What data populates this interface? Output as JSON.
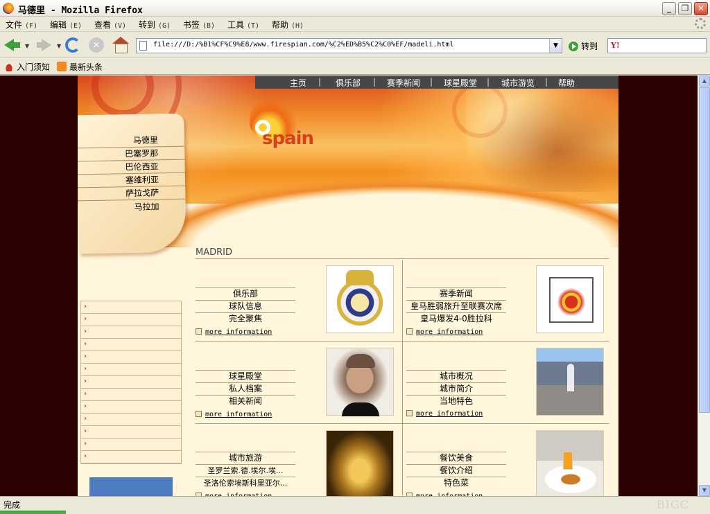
{
  "window": {
    "title": "马德里 - Mozilla Firefox"
  },
  "menu": [
    {
      "label": "文件",
      "key": "(F)"
    },
    {
      "label": "编辑",
      "key": "(E)"
    },
    {
      "label": "查看",
      "key": "(V)"
    },
    {
      "label": "转到",
      "key": "(G)"
    },
    {
      "label": "书签",
      "key": "(B)"
    },
    {
      "label": "工具",
      "key": "(T)"
    },
    {
      "label": "帮助",
      "key": "(H)"
    }
  ],
  "navbar": {
    "url": "file:///D:/%B1%CF%C9%E8/www.firespian.com/%C2%ED%B5%C2%C0%EF/madeli.html",
    "go_label": "转到",
    "search_engine": "Y!"
  },
  "bookmarks": [
    {
      "label": "入门须知",
      "icon": "hat-icon"
    },
    {
      "label": "最新头条",
      "icon": "rss-icon"
    }
  ],
  "site": {
    "topnav": [
      "主页",
      "俱乐部",
      "赛季新闻",
      "球星殿堂",
      "城市游览",
      "帮助"
    ],
    "logo_text": "spain",
    "cities": [
      "马德里",
      "巴塞罗那",
      "巴伦西亚",
      "塞维利亚",
      "萨拉戈萨",
      "马拉加"
    ],
    "section_title": "MADRID",
    "more_label": "more information",
    "cells": [
      {
        "links": [
          "俱乐部",
          "球队信息",
          "完全聚焦"
        ],
        "photo": "real-madrid-crest"
      },
      {
        "links": [
          "赛季新闻",
          "皇马胜弱旅升至联赛次席",
          "皇马爆发4-0胜拉科"
        ],
        "photo": "rfef-crest"
      },
      {
        "links": [
          "球星殿堂",
          "私人档案",
          "相关新闻"
        ],
        "photo": "player-portrait"
      },
      {
        "links": [
          "城市概况",
          "城市简介",
          "当地特色"
        ],
        "photo": "city-fountain"
      },
      {
        "links": [
          "城市旅游",
          "圣罗兰索.德.埃尔.埃...",
          "圣洛伦索埃斯科里亚尔..."
        ],
        "photo": "cibeles-statue"
      },
      {
        "links": [
          "餐饮美食",
          "餐饮介绍",
          "特色菜"
        ],
        "photo": "breakfast-table"
      }
    ]
  },
  "status": {
    "text": "完成",
    "watermark": "BIGC"
  }
}
